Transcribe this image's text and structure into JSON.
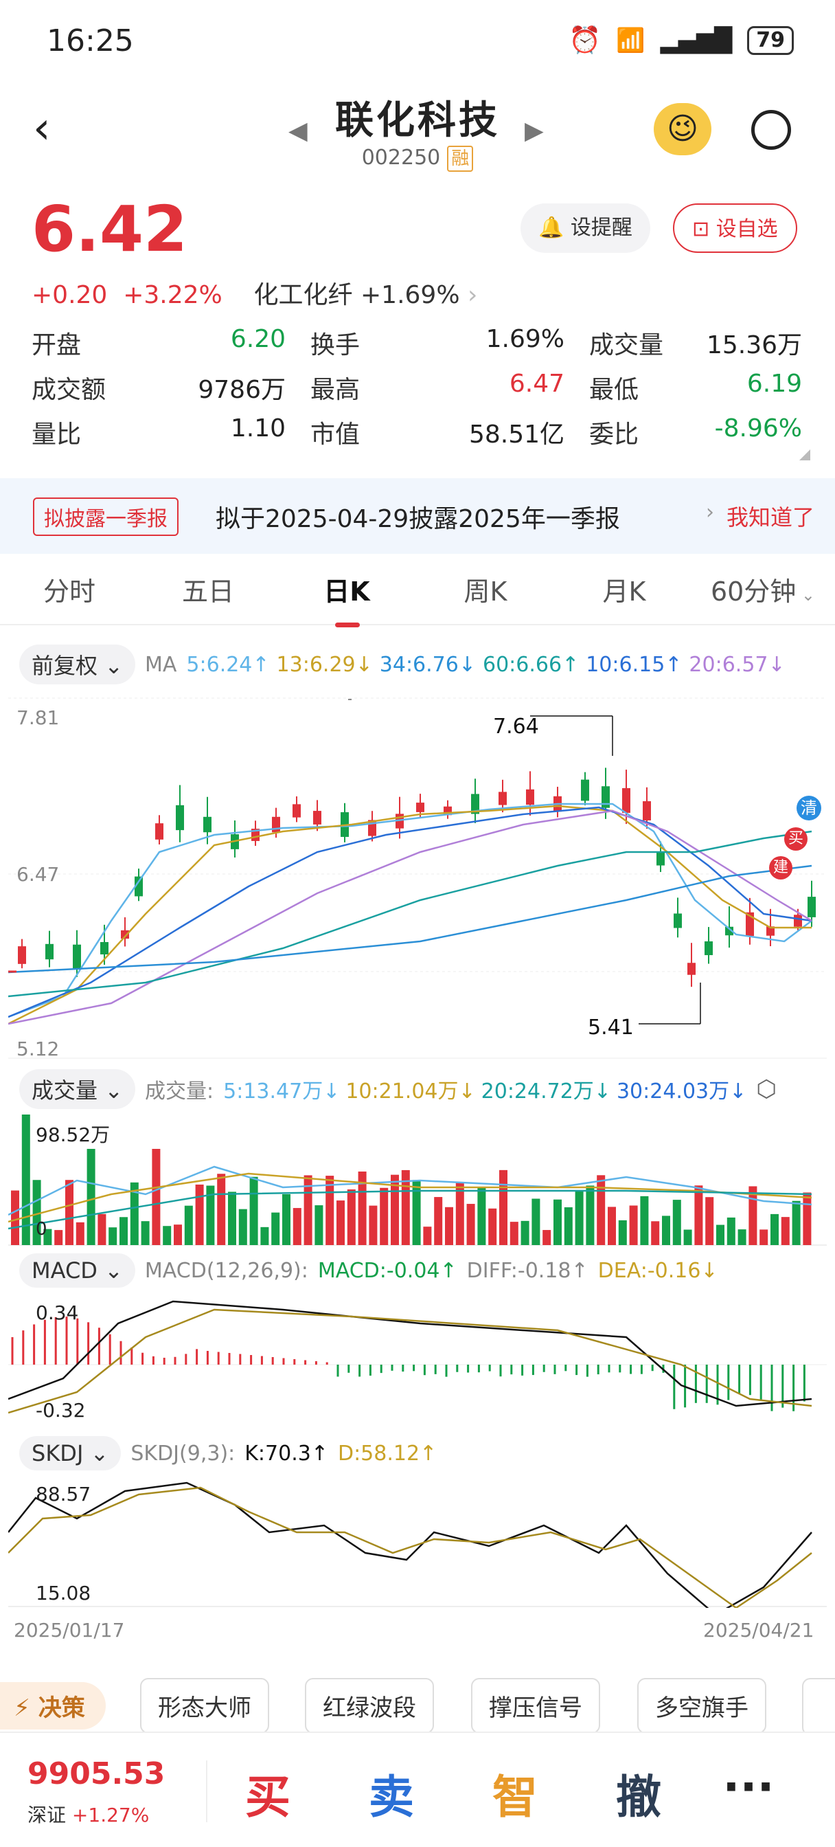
{
  "status": {
    "time": "16:25",
    "battery": "79"
  },
  "header": {
    "name": "联化科技",
    "code": "002250",
    "rong": "融"
  },
  "quote": {
    "price": "6.42",
    "change": "+0.20",
    "change_pct": "+3.22%",
    "sector": "化工化纤",
    "sector_pct": "+1.69%",
    "remind_label": "设提醒",
    "watch_label": "设自选"
  },
  "stats": [
    [
      {
        "l": "开盘",
        "v": "6.20",
        "c": "green"
      },
      {
        "l": "换手",
        "v": "1.69%",
        "c": ""
      },
      {
        "l": "成交量",
        "v": "15.36万",
        "c": ""
      }
    ],
    [
      {
        "l": "成交额",
        "v": "9786万",
        "c": ""
      },
      {
        "l": "最高",
        "v": "6.47",
        "c": "red"
      },
      {
        "l": "最低",
        "v": "6.19",
        "c": "green"
      }
    ],
    [
      {
        "l": "量比",
        "v": "1.10",
        "c": ""
      },
      {
        "l": "市值",
        "v": "58.51亿",
        "c": ""
      },
      {
        "l": "委比",
        "v": "-8.96%",
        "c": "green"
      }
    ]
  ],
  "notice": {
    "tag": "拟披露一季报",
    "text": "拟于2025-04-29披露2025年一季报",
    "action": "我知道了"
  },
  "tabs": [
    "分时",
    "五日",
    "日K",
    "周K",
    "月K",
    "60分钟"
  ],
  "ma": {
    "adj": "前复权",
    "label": "MA",
    "items": [
      {
        "t": "5:6.24↑",
        "c": "#5fb4e8"
      },
      {
        "t": "13:6.29↓",
        "c": "#c9a227"
      },
      {
        "t": "34:6.76↓",
        "c": "#2b8fd6"
      },
      {
        "t": "60:6.66↑",
        "c": "#1aa0a0"
      },
      {
        "t": "10:6.15↑",
        "c": "#2a6fd6"
      },
      {
        "t": "20:6.57↓",
        "c": "#b07fd8"
      }
    ]
  },
  "kline": {
    "top": "7.81",
    "mid": "6.47",
    "bot": "5.12",
    "high_mark": "7.64",
    "low_mark": "5.41",
    "badges": [
      "清",
      "买",
      "建"
    ]
  },
  "volume": {
    "label": "成交量",
    "title": "成交量:",
    "items": [
      {
        "t": "5:13.47万↓",
        "c": "#5fb4e8"
      },
      {
        "t": "10:21.04万↓",
        "c": "#c9a227"
      },
      {
        "t": "20:24.72万↓",
        "c": "#1aa0a0"
      },
      {
        "t": "30:24.03万↓",
        "c": "#2a6fd6"
      }
    ],
    "max": "98.52万",
    "zero": "0"
  },
  "macd": {
    "label": "MACD",
    "params": "MACD(12,26,9):",
    "macd": "MACD:-0.04↑",
    "diff": "DIFF:-0.18↑",
    "dea": "DEA:-0.16↓",
    "top": "0.34",
    "bot": "-0.32"
  },
  "skdj": {
    "label": "SKDJ",
    "params": "SKDJ(9,3):",
    "k": "K:70.3↑",
    "d": "D:58.12↑",
    "top": "88.57",
    "bot": "15.08"
  },
  "dates": {
    "start": "2025/01/17",
    "end": "2025/04/21"
  },
  "tools": {
    "decide": "决策",
    "items": [
      "形态大师",
      "红绿波段",
      "撑压信号",
      "多空旗手"
    ]
  },
  "bottom": {
    "index_val": "9905.53",
    "index_name": "深证",
    "index_pct": "+1.27%",
    "buy": "买",
    "sell": "卖",
    "smart": "智",
    "cancel": "撤",
    "more": "···"
  }
}
